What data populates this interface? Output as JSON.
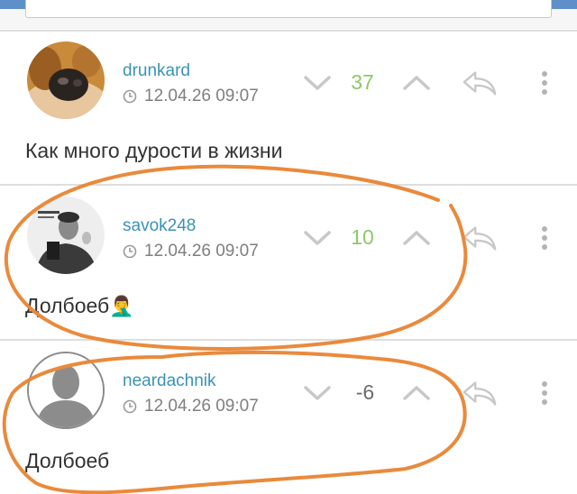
{
  "comments": [
    {
      "username": "drunkard",
      "time": "12.04.26 09:07",
      "score": "37",
      "score_sign": "positive",
      "text": "Как много дурости в жизни",
      "avatar": "dog-photo"
    },
    {
      "username": "savok248",
      "time": "12.04.26 09:07",
      "score": "10",
      "score_sign": "positive",
      "text": "Долбоеб",
      "text_emoji": "🤦‍♂️",
      "avatar": "man-photo"
    },
    {
      "username": "neardachnik",
      "time": "12.04.26 09:07",
      "score": "-6",
      "score_sign": "negative",
      "text": "Долбоеб",
      "avatar": "default-silhouette"
    }
  ],
  "colors": {
    "username": "#3a93b5",
    "score_positive": "#8cc968",
    "score_negative": "#6b6b6b",
    "annotation": "#e98a3c",
    "header_bar": "#5f8fc9"
  },
  "icons": [
    "clock-icon",
    "chevron-down-icon",
    "chevron-up-icon",
    "reply-icon",
    "more-vertical-icon"
  ]
}
